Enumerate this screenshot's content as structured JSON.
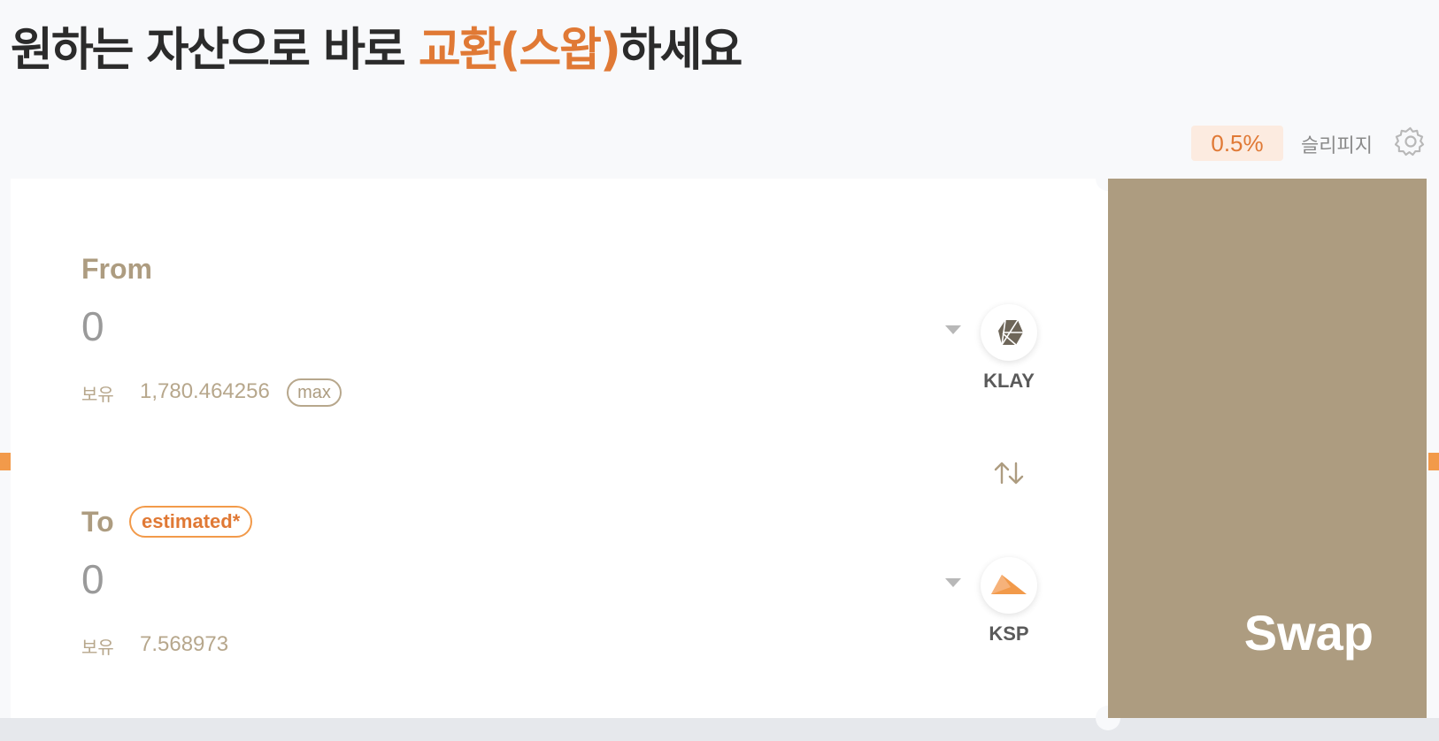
{
  "headline": {
    "prefix": "원하는 자산으로 바로 ",
    "accent": "교환(스왑)",
    "suffix": "하세요"
  },
  "settings": {
    "slippage_value": "0.5%",
    "slippage_label": "슬리피지",
    "icon": "gear-icon"
  },
  "from": {
    "label": "From",
    "amount": "0",
    "balance_label": "보유",
    "balance": "1,780.464256",
    "max_label": "max",
    "token": "KLAY",
    "icon": "klay-token-icon"
  },
  "to": {
    "label": "To",
    "badge": "estimated*",
    "amount": "0",
    "balance_label": "보유",
    "balance": "7.568973",
    "token": "KSP",
    "icon": "ksp-token-icon"
  },
  "switch_icon": "swap-arrows-icon",
  "swap_button": "Swap",
  "colors": {
    "accent": "#e07935",
    "brand_tan": "#ad9c80",
    "klay_dark": "#6e6659",
    "ksp_orange": "#f29a4a"
  }
}
